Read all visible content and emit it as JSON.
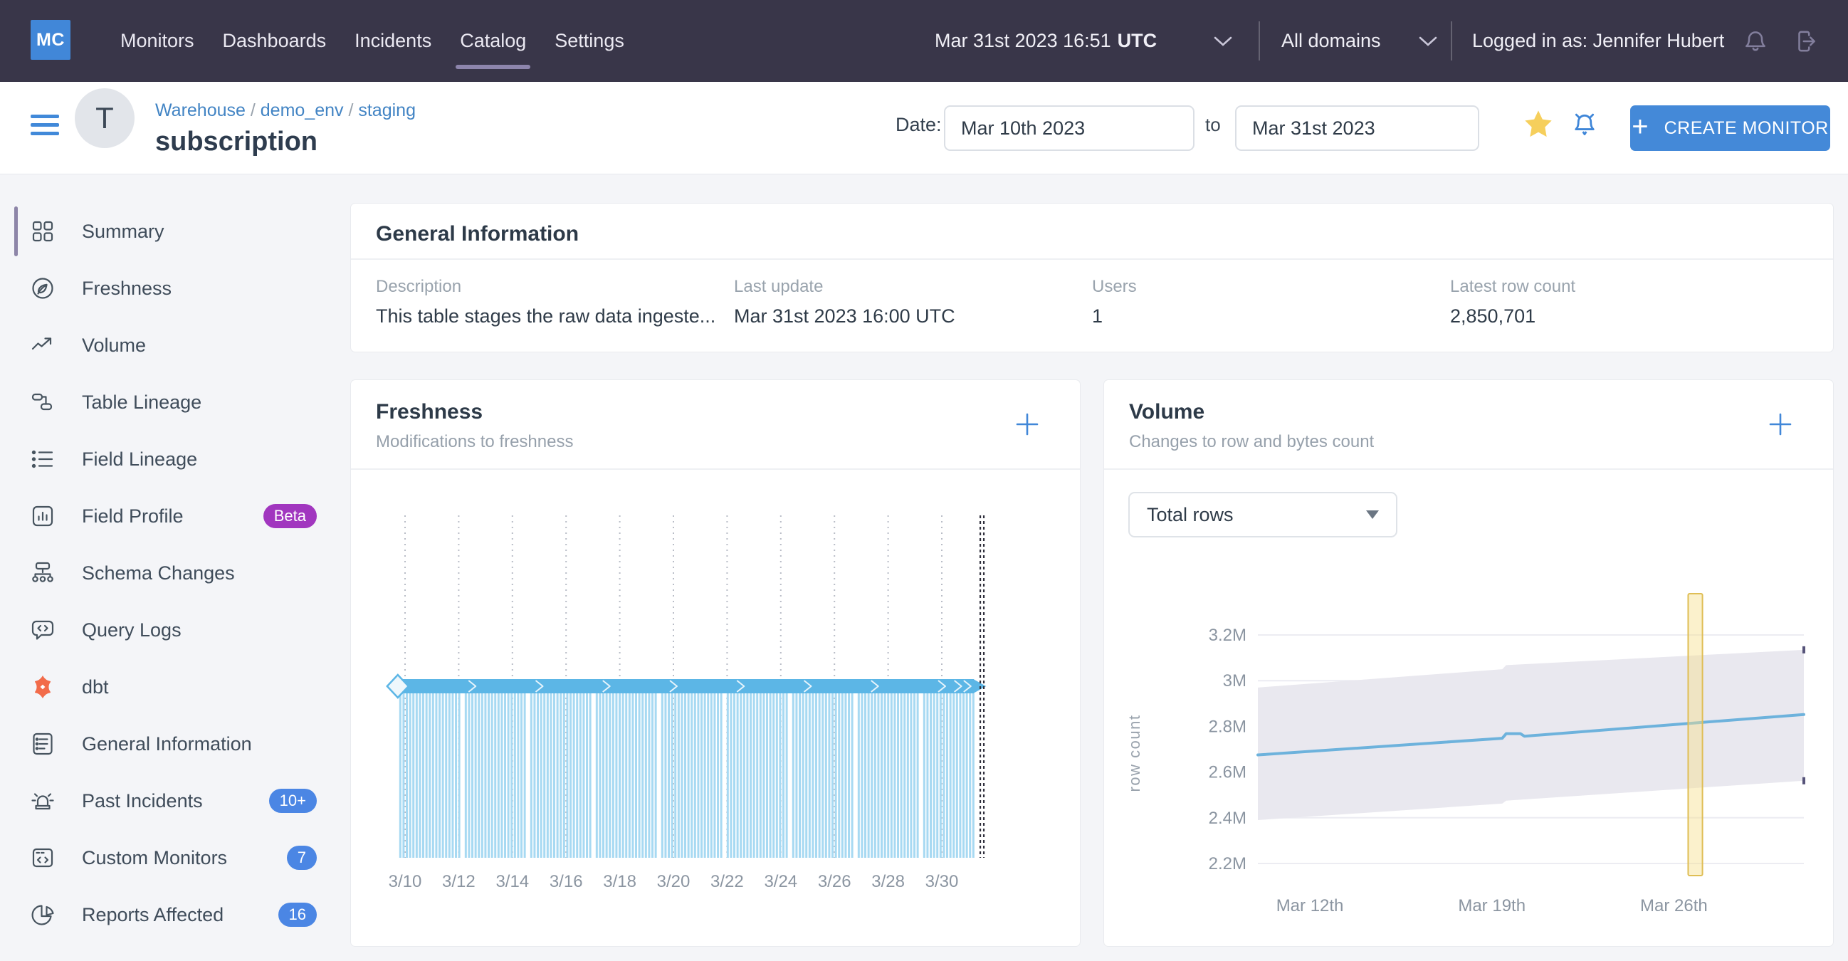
{
  "topnav": {
    "logo_text": "MC",
    "items": [
      {
        "label": "Monitors",
        "active": false
      },
      {
        "label": "Dashboards",
        "active": false
      },
      {
        "label": "Incidents",
        "active": false
      },
      {
        "label": "Catalog",
        "active": true
      },
      {
        "label": "Settings",
        "active": false
      }
    ],
    "datetime": "Mar 31st 2023 16:51",
    "timezone": "UTC",
    "domain_selector": "All domains",
    "user_label": "Logged in as: Jennifer Hubert"
  },
  "header": {
    "breadcrumb": [
      {
        "label": "Warehouse"
      },
      {
        "label": "demo_env"
      },
      {
        "label": "staging"
      }
    ],
    "breadcrumb_separator": "/",
    "title": "subscription",
    "date_label": "Date:",
    "date_from": "Mar 10th 2023",
    "to_label": "to",
    "date_to": "Mar 31st 2023",
    "create_monitor_plus": "+",
    "create_monitor_label": "CREATE MONITOR"
  },
  "sidebar": {
    "items": [
      {
        "label": "Summary",
        "icon": "grid-icon",
        "active": true
      },
      {
        "label": "Freshness",
        "icon": "freshness-icon"
      },
      {
        "label": "Volume",
        "icon": "volume-icon"
      },
      {
        "label": "Table Lineage",
        "icon": "table-lineage-icon"
      },
      {
        "label": "Field Lineage",
        "icon": "field-lineage-icon"
      },
      {
        "label": "Field Profile",
        "icon": "field-profile-icon",
        "badge": {
          "text": "Beta",
          "color": "#a136bf"
        }
      },
      {
        "label": "Schema Changes",
        "icon": "schema-changes-icon"
      },
      {
        "label": "Query Logs",
        "icon": "query-logs-icon"
      },
      {
        "label": "dbt",
        "icon": "dbt-icon"
      },
      {
        "label": "General Information",
        "icon": "general-information-icon"
      },
      {
        "label": "Past Incidents",
        "icon": "past-incidents-icon",
        "badge": {
          "text": "10+",
          "color": "#4b86e4"
        }
      },
      {
        "label": "Custom Monitors",
        "icon": "custom-monitors-icon",
        "badge": {
          "text": "7",
          "color": "#4b86e4"
        }
      },
      {
        "label": "Reports Affected",
        "icon": "reports-affected-icon",
        "badge": {
          "text": "16",
          "color": "#4b86e4"
        }
      }
    ]
  },
  "general_info": {
    "title": "General Information",
    "fields": [
      {
        "label": "Description",
        "value": "This table stages the raw data ingeste..."
      },
      {
        "label": "Last update",
        "value": "Mar 31st 2023 16:00 UTC"
      },
      {
        "label": "Users",
        "value": "1"
      },
      {
        "label": "Latest row count",
        "value": "2,850,701"
      }
    ]
  },
  "freshness_card": {
    "title": "Freshness",
    "subtitle": "Modifications to freshness",
    "chart_data": {
      "type": "event-band-timeline",
      "x_tick_labels": [
        "3/10",
        "3/12",
        "3/14",
        "3/16",
        "3/18",
        "3/20",
        "3/22",
        "3/24",
        "3/26",
        "3/28",
        "3/30"
      ],
      "x_tick_days": [
        0,
        2,
        4,
        6,
        8,
        10,
        12,
        14,
        16,
        18,
        20
      ],
      "band_start_day": -0.27,
      "band_end_day": 21.2,
      "now_line_day": 21.5,
      "chevron_days": [
        2.5,
        5,
        7.5,
        10,
        12.5,
        15,
        17.5,
        20
      ],
      "band_color": "#5cb6e6",
      "bars_color": "#a7d9f2",
      "description": "Continuous freshness updates from 3/10 through now (Mar 31st)"
    }
  },
  "volume_card": {
    "title": "Volume",
    "subtitle": "Changes to row and bytes count",
    "dropdown_value": "Total rows",
    "chart_data": {
      "type": "line",
      "ylabel": "row count",
      "units": "millions of rows",
      "y_tick_labels": [
        "3.2M",
        "3M",
        "2.8M",
        "2.6M",
        "2.4M",
        "2.2M"
      ],
      "y_tick_values": [
        3.2,
        3.0,
        2.8,
        2.6,
        2.4,
        2.2
      ],
      "x_tick_labels": [
        "Mar 12th",
        "Mar 19th",
        "Mar 26th"
      ],
      "x_tick_days": [
        2,
        9,
        16
      ],
      "x_domain_days": [
        0,
        21
      ],
      "line_color": "#6db2dc",
      "line_points_day_value": [
        [
          0,
          2.675
        ],
        [
          9.4,
          2.748
        ],
        [
          9.55,
          2.768
        ],
        [
          10.1,
          2.768
        ],
        [
          10.25,
          2.757
        ],
        [
          21,
          2.852
        ]
      ],
      "expected_band_color": "#e9e8ef",
      "expected_upper_day_value": [
        [
          0,
          2.97
        ],
        [
          9.4,
          3.05
        ],
        [
          9.55,
          3.068
        ],
        [
          21,
          3.135
        ]
      ],
      "expected_lower_day_value": [
        [
          0,
          2.39
        ],
        [
          9.4,
          2.462
        ],
        [
          9.55,
          2.475
        ],
        [
          21,
          2.562
        ]
      ],
      "highlight_band_days": [
        16.55,
        17.1
      ],
      "highlight_fill": "#f7e08d",
      "highlight_border": "#dfbe55"
    }
  },
  "colors": {
    "accent_blue": "#4187d8",
    "badge_blue": "#4b86e4",
    "beta_purple": "#a136bf",
    "topnav_bg": "#393649",
    "page_bg": "#f4f5f8",
    "dbt_orange": "#f26b4a",
    "star_yellow": "#f6cf5c"
  }
}
